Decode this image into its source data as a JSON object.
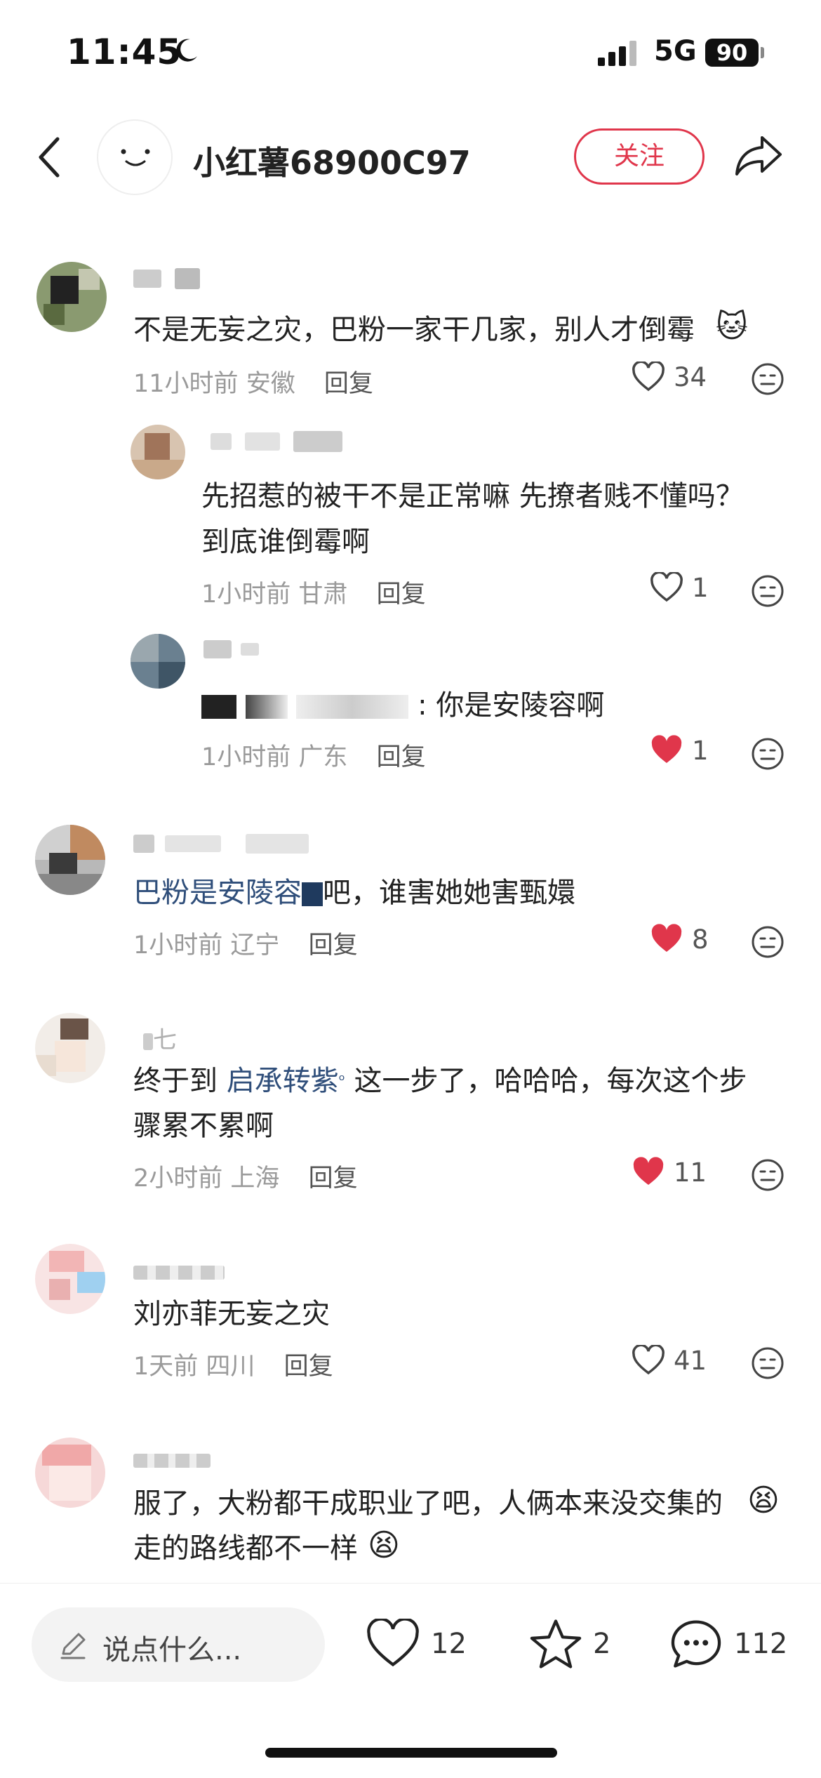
{
  "status_bar": {
    "time": "11:45",
    "network": "5G",
    "battery": "90"
  },
  "header": {
    "username": "小红薯68900C97",
    "follow_label": "关注"
  },
  "comments": [
    {
      "text": "不是无妄之灾，巴粉一家干几家，别人才倒霉",
      "time": "11小时前",
      "location": "安徽",
      "reply_label": "回复",
      "likes": "34",
      "liked": false,
      "replies": [
        {
          "text_line1": "先招惹的被干不是正常嘛 先撩者贱不懂吗？",
          "text_line2": "到底谁倒霉啊",
          "time": "1小时前",
          "location": "甘肃",
          "reply_label": "回复",
          "likes": "1",
          "liked": false
        },
        {
          "text_suffix": ": 你是安陵容啊",
          "time": "1小时前",
          "location": "广东",
          "reply_label": "回复",
          "likes": "1",
          "liked": true
        }
      ]
    },
    {
      "text_link": "巴粉是安陵容",
      "text_rest": "吧，谁害她她害甄嬛",
      "time": "1小时前",
      "location": "辽宁",
      "reply_label": "回复",
      "likes": "8",
      "liked": true
    },
    {
      "name": "七",
      "text_prefix": "终于到 ",
      "text_link": "启承转紫",
      "text_rest": " 这一步了，哈哈哈，每次这个步",
      "text_line2": "骤累不累啊",
      "time": "2小时前",
      "location": "上海",
      "reply_label": "回复",
      "likes": "11",
      "liked": true
    },
    {
      "text": "刘亦菲无妄之灾",
      "time": "1天前",
      "location": "四川",
      "reply_label": "回复",
      "likes": "41",
      "liked": false
    },
    {
      "text_line1": "服了，大粉都干成职业了吧，人俩本来没交集的",
      "text_line2": "走的路线都不一样"
    }
  ],
  "bottom_bar": {
    "input_placeholder": "说点什么...",
    "likes": "12",
    "favorites": "2",
    "comments": "112"
  },
  "colors": {
    "accent": "#e0364b",
    "link": "#2f4e7a",
    "meta": "#9a9a9a"
  }
}
